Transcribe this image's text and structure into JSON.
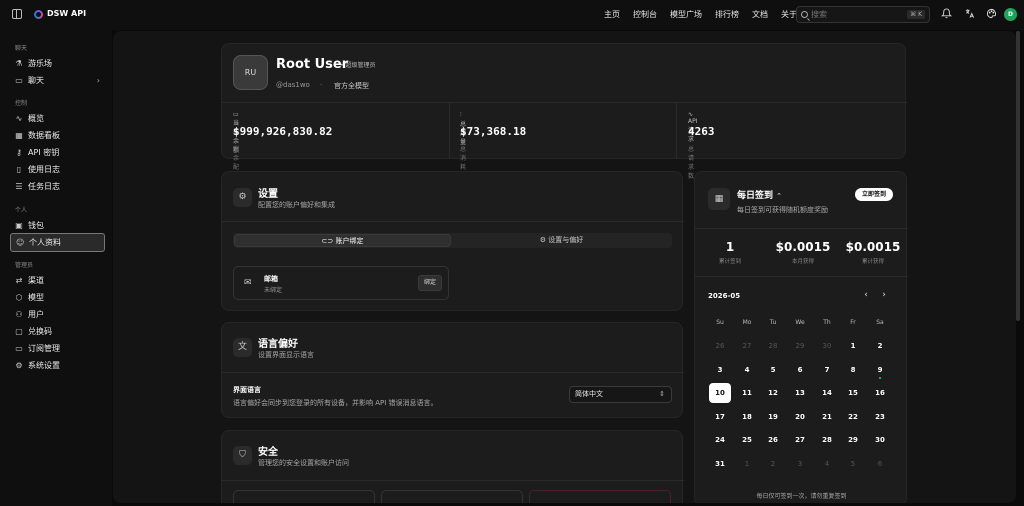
{
  "app": {
    "brand": "DSW API"
  },
  "topnav": [
    "主页",
    "控制台",
    "模型广场",
    "排行榜",
    "文档",
    "关于"
  ],
  "search": {
    "placeholder": "搜索",
    "shortcut": "⌘ K"
  },
  "user_avatar_letter": "D",
  "sidebar": {
    "sections": [
      {
        "title": "聊天",
        "items": [
          {
            "label": "游乐场",
            "icon": "flask-icon"
          },
          {
            "label": "聊天",
            "icon": "chat-icon",
            "chevron": true
          }
        ]
      },
      {
        "title": "控制",
        "items": [
          {
            "label": "概览",
            "icon": "activity-icon"
          },
          {
            "label": "数据看板",
            "icon": "dashboard-icon"
          },
          {
            "label": "API 密钥",
            "icon": "key-icon"
          },
          {
            "label": "使用日志",
            "icon": "file-icon"
          },
          {
            "label": "任务日志",
            "icon": "list-icon"
          }
        ]
      },
      {
        "title": "个人",
        "items": [
          {
            "label": "钱包",
            "icon": "wallet-icon"
          },
          {
            "label": "个人资料",
            "icon": "user-icon",
            "active": true
          }
        ]
      },
      {
        "title": "管理员",
        "items": [
          {
            "label": "渠道",
            "icon": "channel-icon"
          },
          {
            "label": "模型",
            "icon": "box-icon"
          },
          {
            "label": "用户",
            "icon": "users-icon"
          },
          {
            "label": "兑换码",
            "icon": "ticket-icon"
          },
          {
            "label": "订阅管理",
            "icon": "card-icon"
          },
          {
            "label": "系统设置",
            "icon": "gear-icon"
          }
        ]
      }
    ]
  },
  "profile": {
    "initials": "RU",
    "name": "Root User",
    "role": "超级管理员",
    "handle": "@das1wo",
    "dot": "·",
    "group": "官方全模型",
    "stats": [
      {
        "label": "当前余额",
        "value": "$999,926,830.82",
        "sub": "剩余配额"
      },
      {
        "label": "总用量",
        "value": "$73,368.18",
        "sub": "总消耗额度"
      },
      {
        "label": "API 请求",
        "value": "4263",
        "sub": "总请求数"
      }
    ]
  },
  "settings": {
    "title": "设置",
    "subtitle": "配置您的账户偏好和集成",
    "tabs": [
      "账户绑定",
      "设置与偏好"
    ],
    "email": {
      "label": "邮箱",
      "status": "未绑定",
      "button": "绑定"
    }
  },
  "language": {
    "title": "语言偏好",
    "subtitle": "设置界面显示语言",
    "field_label": "界面语言",
    "field_desc": "语言偏好会同步到您登录的所有设备，并影响 API 错误消息语言。",
    "selected": "简体中文"
  },
  "security": {
    "title": "安全",
    "subtitle": "管理您的安全设置和账户访问"
  },
  "checkin": {
    "title": "每日签到",
    "subtitle": "每日签到可获得随机额度奖励",
    "button": "立即签到",
    "stats": [
      {
        "value": "1",
        "label": "累计签到"
      },
      {
        "value": "$0.0015",
        "label": "本月获得"
      },
      {
        "value": "$0.0015",
        "label": "累计获得"
      }
    ],
    "month": "2026-05",
    "weekdays": [
      "Su",
      "Mo",
      "Tu",
      "We",
      "Th",
      "Fr",
      "Sa"
    ],
    "weeks": [
      [
        "26",
        "27",
        "28",
        "29",
        "30",
        "1",
        "2"
      ],
      [
        "3",
        "4",
        "5",
        "6",
        "7",
        "8",
        "9"
      ],
      [
        "10",
        "11",
        "12",
        "13",
        "14",
        "15",
        "16"
      ],
      [
        "17",
        "18",
        "19",
        "20",
        "21",
        "22",
        "23"
      ],
      [
        "24",
        "25",
        "26",
        "27",
        "28",
        "29",
        "30"
      ],
      [
        "31",
        "1",
        "2",
        "3",
        "4",
        "5",
        "6"
      ]
    ],
    "today": "10",
    "signed_day": "9",
    "footer": "每日仅可签到一次，请勿重复签到"
  }
}
